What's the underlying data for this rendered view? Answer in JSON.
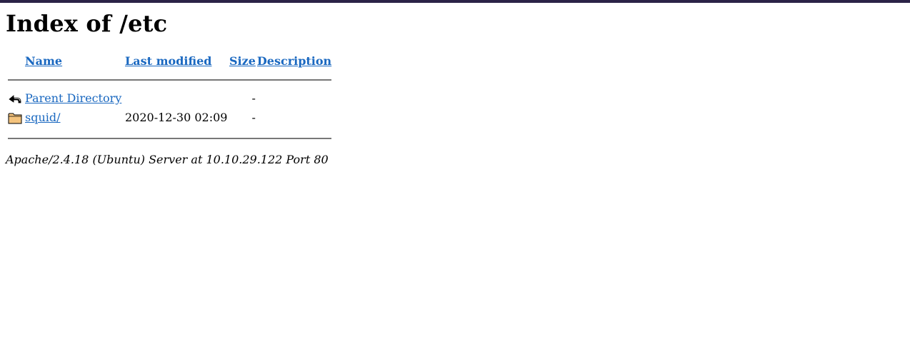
{
  "page": {
    "title": "Index of /etc"
  },
  "table": {
    "headers": {
      "name": "Name",
      "last_modified": "Last modified",
      "size": "Size",
      "description": "Description"
    },
    "rows": [
      {
        "icon": "back-icon",
        "name": "Parent Directory",
        "last_modified": "",
        "size": "-",
        "description": ""
      },
      {
        "icon": "folder-icon",
        "name": "squid/",
        "last_modified": "2020-12-30 02:09",
        "size": "-",
        "description": ""
      }
    ]
  },
  "footer": {
    "address": "Apache/2.4.18 (Ubuntu) Server at 10.10.29.122 Port 80"
  },
  "colors": {
    "link": "#1a68c0",
    "top_bar": "#2b2347",
    "rule": "#777777"
  }
}
